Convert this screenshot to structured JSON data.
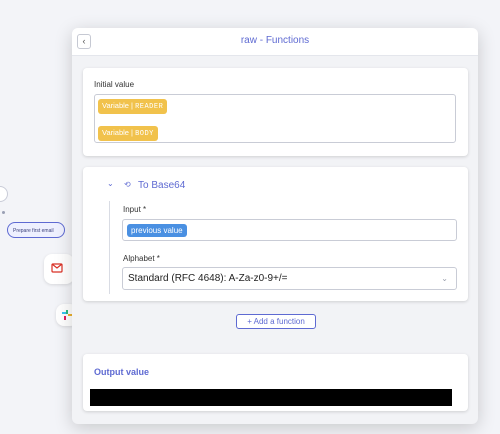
{
  "canvas": {
    "node_label": "Prepare first email"
  },
  "panel": {
    "back_glyph": "‹",
    "title": "raw - Functions"
  },
  "initial_value": {
    "label": "Initial value",
    "tags": [
      {
        "prefix": "Variable | ",
        "name": "READER"
      },
      {
        "prefix": "Variable | ",
        "name": "BODY"
      }
    ]
  },
  "function": {
    "collapse_glyph": "⌄",
    "icon_glyph": "⟲",
    "name": "To Base64",
    "input_label": "Input *",
    "input_tag": "previous value",
    "alphabet_label": "Alphabet *",
    "alphabet_value": "Standard (RFC 4648): A-Za-z0-9+/=",
    "alphabet_chevron": "⌄"
  },
  "add_function": {
    "label": "+ Add a function"
  },
  "output": {
    "label": "Output value"
  }
}
